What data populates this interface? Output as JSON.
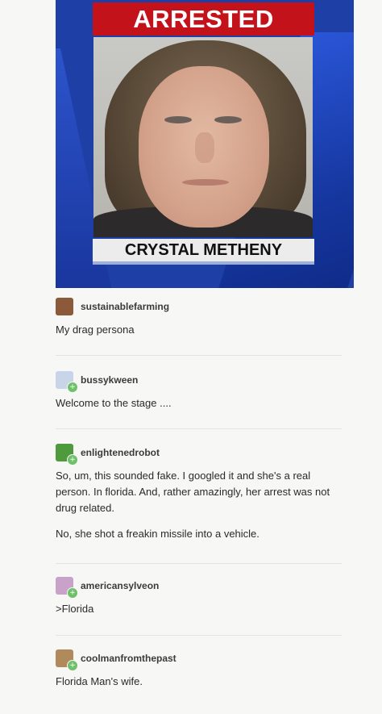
{
  "news_graphic": {
    "banner_text": "ARRESTED",
    "caption_name": "CRYSTAL METHENY",
    "colors": {
      "banner": "#c4121b",
      "background": "#1e3fa6"
    }
  },
  "thread": [
    {
      "username": "sustainablefarming",
      "avatar_icon": "farm-photo-avatar-icon",
      "avatar_color": "#8a5a3b",
      "badge": false,
      "body": [
        "My drag persona"
      ]
    },
    {
      "username": "bussykween",
      "avatar_icon": "flower-avatar-icon",
      "avatar_color": "#c8d5e8",
      "badge": true,
      "body": [
        "Welcome to the stage ...."
      ]
    },
    {
      "username": "enlightenedrobot",
      "avatar_icon": "green-leaf-avatar-icon",
      "avatar_color": "#4f9a3c",
      "badge": true,
      "body": [
        "So, um, this sounded fake. I googled it and she's a real person. In florida. And, rather amazingly, her arrest was not drug related.",
        "No, she shot a freakin missile into a vehicle."
      ]
    },
    {
      "username": "americansylveon",
      "avatar_icon": "pink-creature-avatar-icon",
      "avatar_color": "#c9a2c9",
      "badge": true,
      "body": [
        ">Florida"
      ]
    },
    {
      "username": "coolmanfromthepast",
      "avatar_icon": "portrait-avatar-icon",
      "avatar_color": "#b08a5c",
      "badge": true,
      "body": [
        "Florida Man's wife."
      ]
    }
  ]
}
